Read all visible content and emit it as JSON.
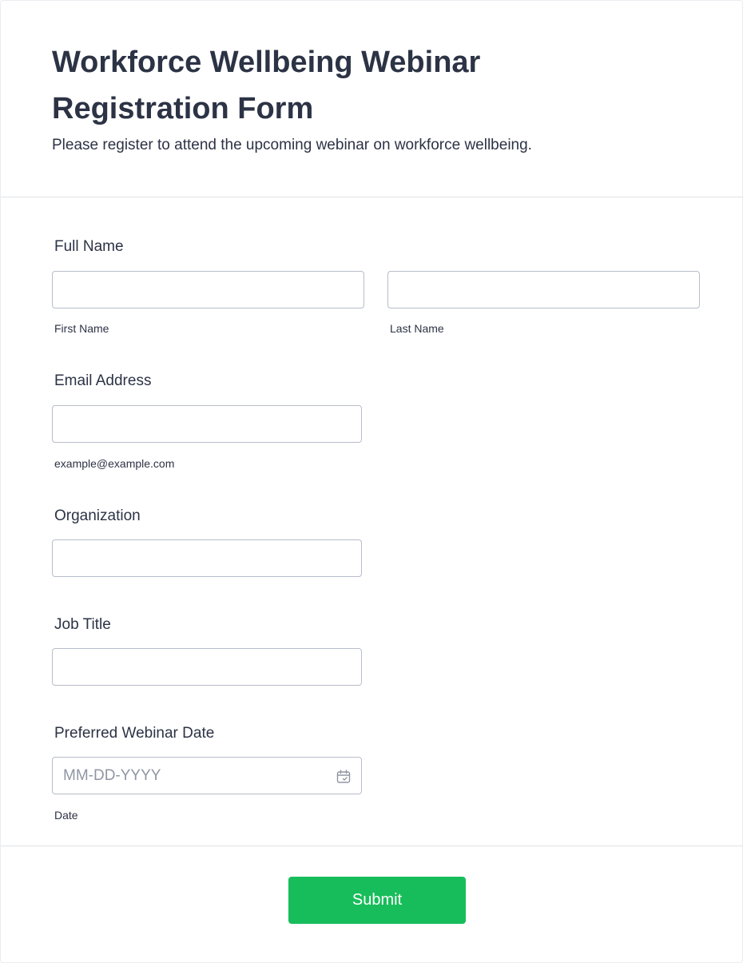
{
  "form": {
    "title": "Workforce Wellbeing Webinar Registration Form",
    "subtitle": "Please register to attend the upcoming webinar on workforce wellbeing."
  },
  "fields": {
    "full_name": {
      "label": "Full Name",
      "first_sublabel": "First Name",
      "last_sublabel": "Last Name",
      "first_value": "",
      "last_value": ""
    },
    "email": {
      "label": "Email Address",
      "sublabel": "example@example.com",
      "value": ""
    },
    "organization": {
      "label": "Organization",
      "value": ""
    },
    "job_title": {
      "label": "Job Title",
      "value": ""
    },
    "webinar_date": {
      "label": "Preferred Webinar Date",
      "placeholder": "MM-DD-YYYY",
      "sublabel": "Date",
      "icon": "calendar-icon"
    }
  },
  "actions": {
    "submit_label": "Submit"
  },
  "colors": {
    "text": "#2c3345",
    "input_border": "#b8bdc9",
    "placeholder": "#8f96a3",
    "submit_bg": "#18bd5b",
    "divider": "#dfe2e7"
  }
}
